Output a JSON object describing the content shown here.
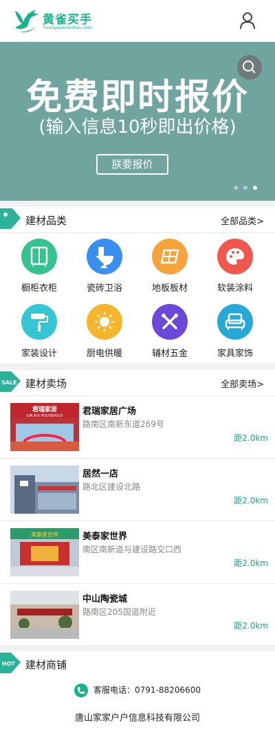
{
  "header": {
    "brand": "黄雀买手",
    "brand_sub": "huangquemaishou.com",
    "user_icon": "user-icon"
  },
  "banner": {
    "title": "免费即时报价",
    "subtitle": "(输入信息10秒即出价格)",
    "button": "朕要报价",
    "search_icon": "search-icon",
    "dots": 3,
    "active_dot": 3
  },
  "categories": {
    "title": "建材品类",
    "more": "全部品类>",
    "badge_icon": "tag-icon",
    "items": [
      {
        "label": "橱柜衣柜",
        "icon": "cabinet-icon",
        "color": "#35c48f"
      },
      {
        "label": "瓷砖卫浴",
        "icon": "toilet-icon",
        "color": "#3a8ef0"
      },
      {
        "label": "地板板材",
        "icon": "floor-icon",
        "color": "#f5a43b"
      },
      {
        "label": "软装涂料",
        "icon": "palette-icon",
        "color": "#f0584e"
      },
      {
        "label": "家装设计",
        "icon": "paint-roller-icon",
        "color": "#34c6d4"
      },
      {
        "label": "厨电供暖",
        "icon": "sun-icon",
        "color": "#f5b62b"
      },
      {
        "label": "辅材五金",
        "icon": "tools-icon",
        "color": "#6c48d8"
      },
      {
        "label": "家具家饰",
        "icon": "armchair-icon",
        "color": "#26a9d6"
      }
    ]
  },
  "market": {
    "title": "建材卖场",
    "more": "全部卖场>",
    "badge_text": "SALE",
    "stores": [
      {
        "name": "君瑞家居广场",
        "addr": "路南区南新东道269号",
        "dist": "距2.0km",
        "img_label": "君瑞家居 JUN RUI HOUSEHOLD"
      },
      {
        "name": "居然一店",
        "addr": "路北区建设北路",
        "dist": "距2.0km",
        "img_label": ""
      },
      {
        "name": "美泰家世界",
        "addr": "南区南新道与建设路交口西",
        "dist": "距2.0km",
        "img_label": ""
      },
      {
        "name": "中山陶瓷城",
        "addr": "路南区205国道附近",
        "dist": "距2.0km",
        "img_label": ""
      }
    ]
  },
  "shops": {
    "title": "建材商铺",
    "badge_text": "HOT"
  },
  "footer": {
    "phone": "客服电话：0791-88206600",
    "company": "唐山家家户户信息科技有限公司"
  },
  "colors": {
    "brand": "#19b38a",
    "banner_bg": "#6fa59e",
    "distance": "#19a885"
  }
}
